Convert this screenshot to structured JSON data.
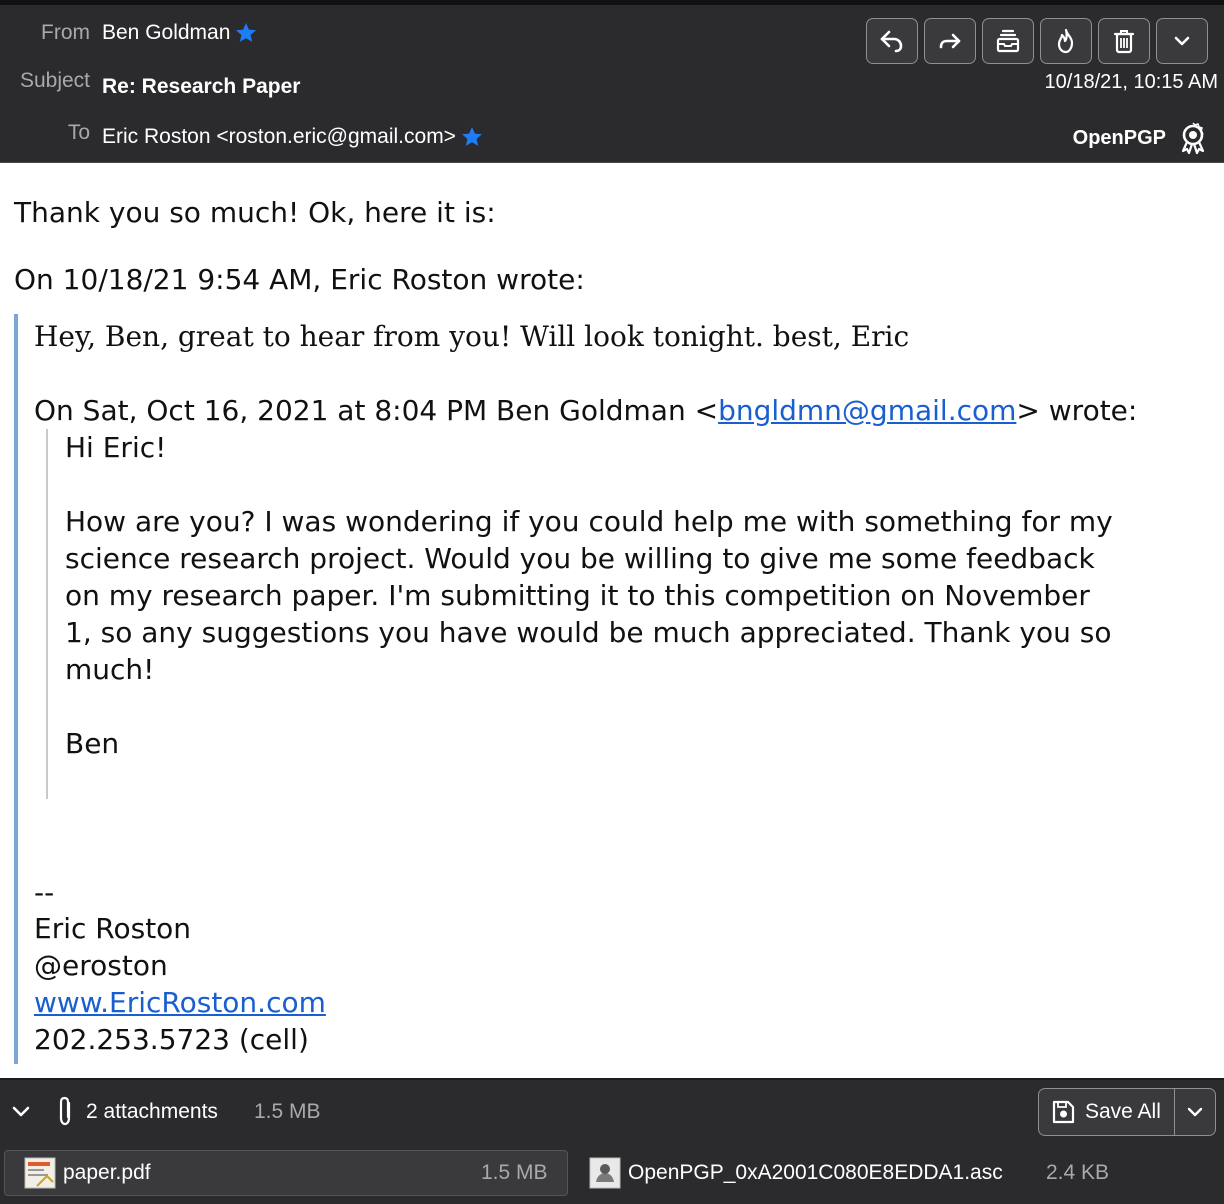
{
  "header": {
    "from_label": "From",
    "from_value": "Ben Goldman",
    "subject_label": "Subject",
    "subject_value": "Re: Research Paper",
    "to_label": "To",
    "to_value": "Eric Roston <roston.eric@gmail.com>",
    "date": "10/18/21, 10:15 AM",
    "openpgp_label": "OpenPGP",
    "toolbar": [
      "reply-icon",
      "forward-icon",
      "archive-icon",
      "junk-icon",
      "trash-icon",
      "more-icon"
    ]
  },
  "body": {
    "line1": "Thank you so much! Ok, here it is:",
    "attribution1": "On 10/18/21 9:54 AM, Eric Roston wrote:",
    "quote1": "Hey, Ben, great to hear from you! Will look tonight. best, Eric",
    "attribution2_pre": "On Sat, Oct 16, 2021 at 8:04 PM Ben Goldman <",
    "attribution2_link": "bngldmn@gmail.com",
    "attribution2_post": "> wrote:",
    "q2_greeting": "Hi Eric!",
    "q2_para": [
      "How are you? I was wondering if you could help me with something for my",
      "science research project. Would you be willing to give me some feedback",
      "on my research paper. I'm submitting it to this competition on November",
      "1, so any suggestions you have would be much appreciated. Thank you so",
      "much!"
    ],
    "q2_sign": "Ben",
    "sig_dashes": "--",
    "sig_name": "Eric Roston",
    "sig_handle": "@eroston",
    "sig_site": "www.EricRoston.com",
    "sig_phone": "202.253.5723 (cell)"
  },
  "attachments": {
    "count_label": "2 attachments",
    "total_size": "1.5 MB",
    "save_all_label": "Save All",
    "items": [
      {
        "name": "paper.pdf",
        "size": "1.5 MB"
      },
      {
        "name": "OpenPGP_0xA2001C080E8EDDA1.asc",
        "size": "2.4 KB"
      }
    ]
  },
  "colors": {
    "header_bg": "#2b2b2e",
    "star": "#1e7cf5",
    "link": "#1a5fcf",
    "quote_bar": "#7ba7d6"
  }
}
